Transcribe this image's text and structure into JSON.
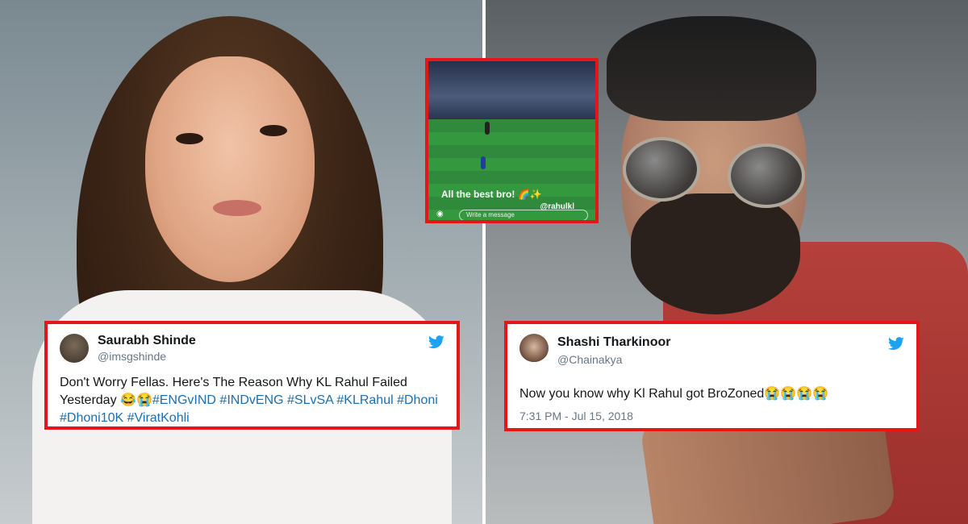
{
  "left_tweet": {
    "name": "Saurabh Shinde",
    "handle": "@imsgshinde",
    "text_line1": "Don't Worry Fellas. Here's The Reason Why KL Rahul Failed",
    "text_line2_plain": "Yesterday 😂😭",
    "tags_line2": "#ENGvIND #INDvENG #SLvSA #KLRahul #Dhoni",
    "tags_line3": "#Dhoni10K #ViratKohli",
    "bird_icon": "twitter-bird-icon"
  },
  "right_tweet": {
    "name": "Shashi Tharkinoor",
    "handle": "@Chainakya",
    "text": "Now you know why Kl Rahul got BroZoned😭😭😭😭",
    "time": "7:31 PM - Jul 15, 2018",
    "bird_icon": "twitter-bird-icon"
  },
  "story": {
    "caption": "All the best bro! 🌈✨",
    "mention": "@rahulkl",
    "message_placeholder": "Write a message"
  },
  "colors": {
    "highlight_border": "#e5161a",
    "twitter_blue": "#1da1f2",
    "hashtag": "#1b6fb0"
  }
}
